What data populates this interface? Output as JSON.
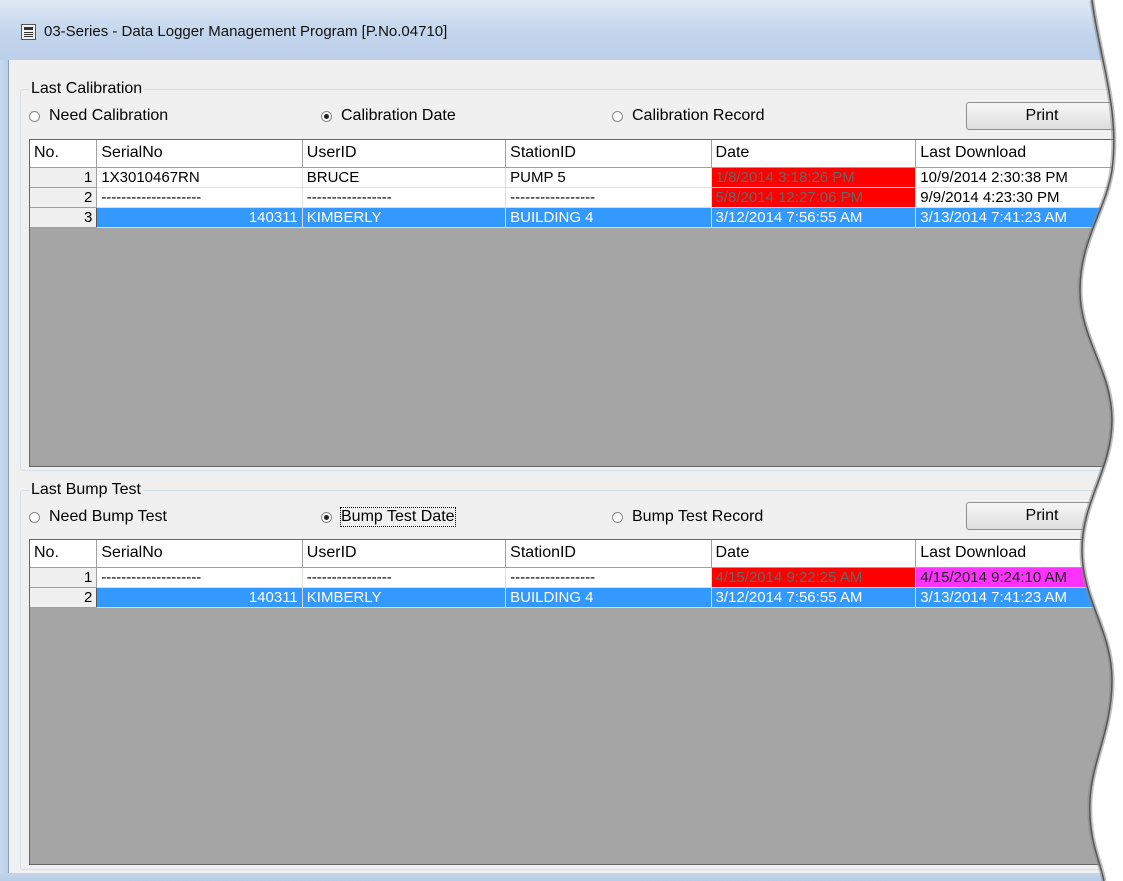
{
  "window": {
    "title": "03-Series  - Data Logger Management Program [P.No.04710]"
  },
  "calibration": {
    "legend": "Last Calibration",
    "radio_need": "Need Calibration",
    "radio_date": "Calibration Date",
    "radio_record": "Calibration Record",
    "selected": "date",
    "print_label": "Print",
    "headers": [
      "No.",
      "SerialNo",
      "UserID",
      "StationID",
      "Date",
      "Last Download"
    ],
    "rows": [
      {
        "no": "1",
        "serial": "1X3010467RN",
        "user": "BRUCE",
        "station": "PUMP 5",
        "date": "1/8/2014 3:18:26 PM",
        "last_download": "10/9/2014 2:30:38 PM",
        "date_status": "red",
        "download_status": "",
        "selected": false
      },
      {
        "no": "2",
        "serial": "--------------------",
        "user": "-----------------",
        "station": "-----------------",
        "date": "5/8/2014 12:27:06 PM",
        "last_download": "9/9/2014 4:23:30 PM",
        "date_status": "red",
        "download_status": "",
        "selected": false
      },
      {
        "no": "3",
        "serial": "140311",
        "user": "KIMBERLY",
        "station": "BUILDING 4",
        "date": "3/12/2014 7:56:55 AM",
        "last_download": "3/13/2014 7:41:23 AM",
        "date_status": "",
        "download_status": "",
        "selected": true
      }
    ]
  },
  "bump": {
    "legend": "Last Bump Test",
    "radio_need": "Need Bump Test",
    "radio_date": "Bump Test Date",
    "radio_record": "Bump Test Record",
    "selected": "date",
    "print_label": "Print",
    "headers": [
      "No.",
      "SerialNo",
      "UserID",
      "StationID",
      "Date",
      "Last Download"
    ],
    "rows": [
      {
        "no": "1",
        "serial": "--------------------",
        "user": "-----------------",
        "station": "-----------------",
        "date": "4/15/2014 9:22:25 AM",
        "last_download": "4/15/2014 9:24:10 AM",
        "date_status": "red",
        "download_status": "magenta",
        "selected": false
      },
      {
        "no": "2",
        "serial": "140311",
        "user": "KIMBERLY",
        "station": "BUILDING 4",
        "date": "3/12/2014 7:56:55 AM",
        "last_download": "3/13/2014 7:41:23 AM",
        "date_status": "",
        "download_status": "",
        "selected": true
      }
    ]
  },
  "colors": {
    "selection": "#3399ff",
    "overdue": "#ff0000",
    "download_overdue": "#ff33ff",
    "grid_background": "#a5a5a5"
  }
}
